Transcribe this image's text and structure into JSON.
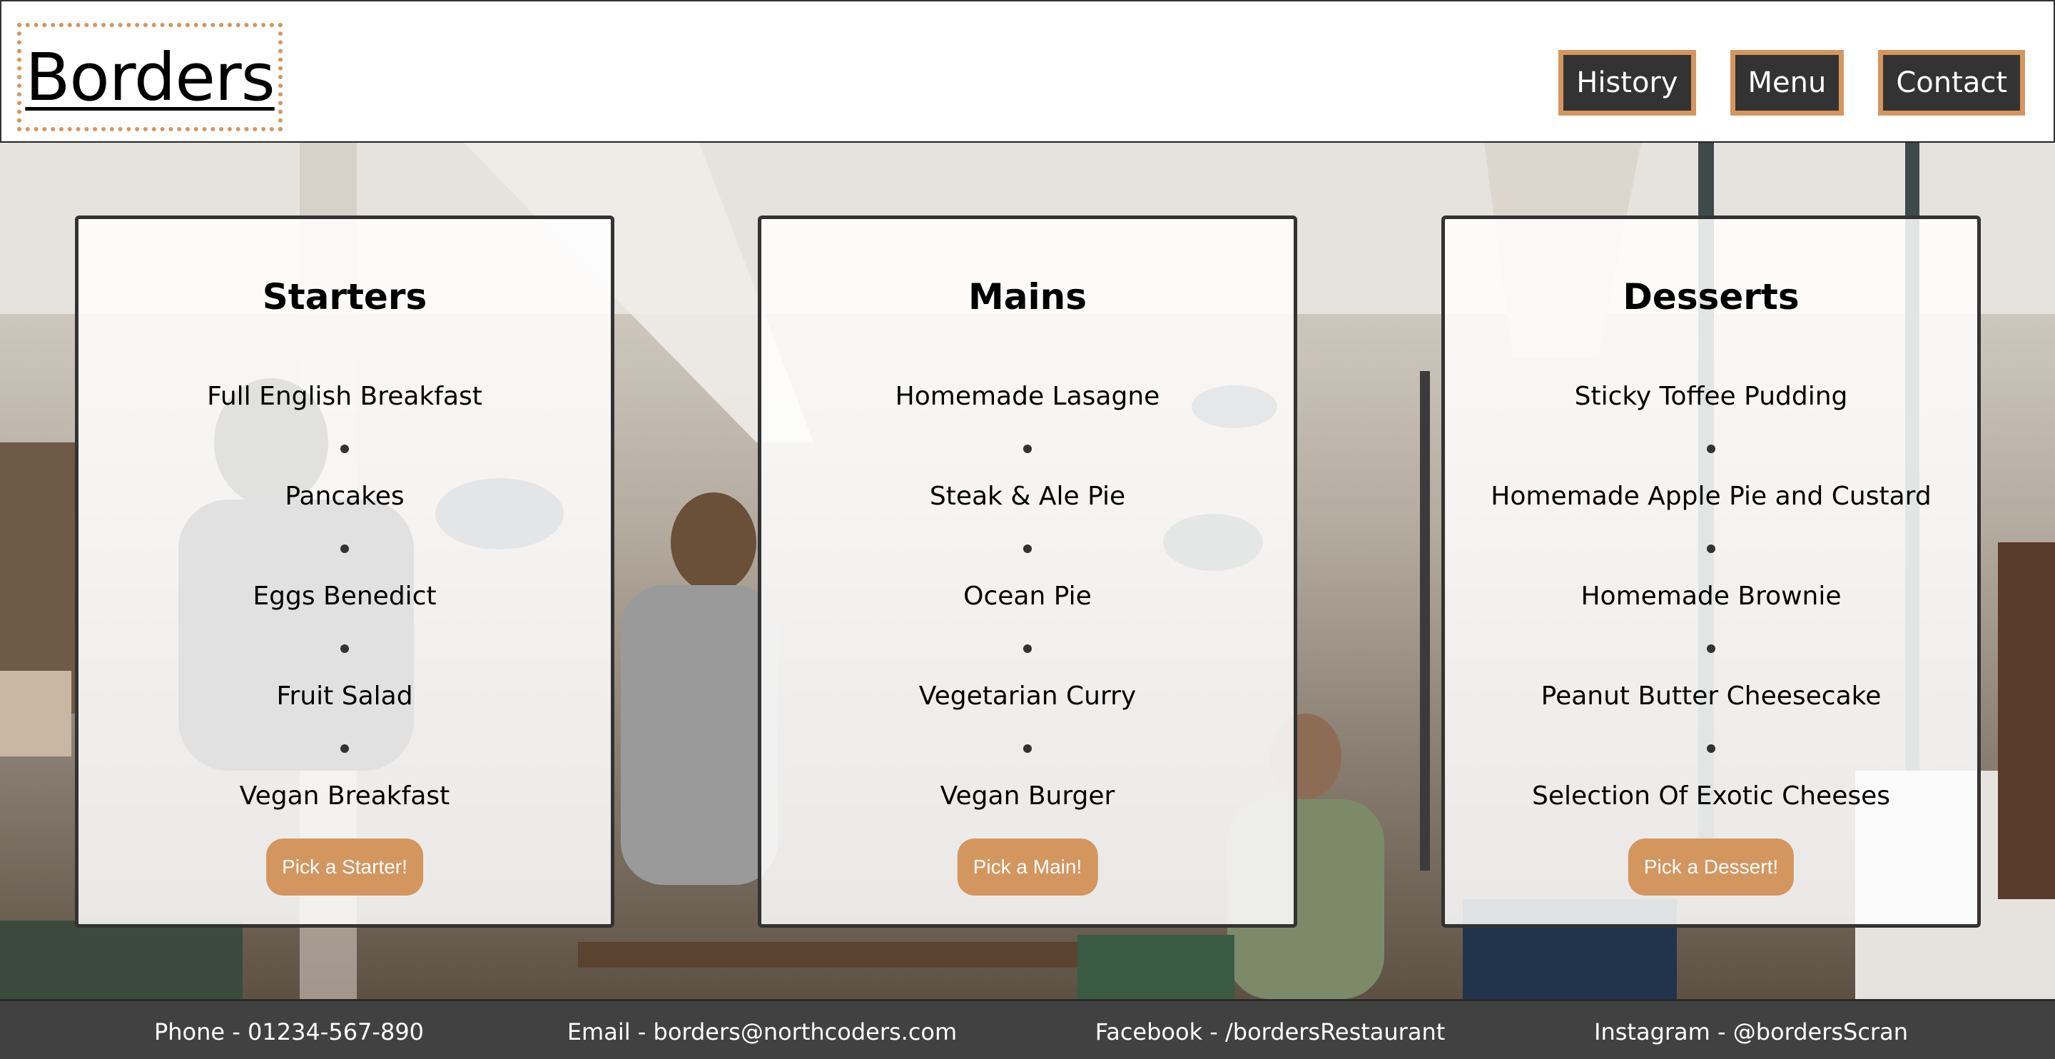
{
  "header": {
    "logo": "Borders",
    "nav": [
      "History",
      "Menu",
      "Contact"
    ]
  },
  "menu": [
    {
      "title": "Starters",
      "dishes": [
        "Full English Breakfast",
        "Pancakes",
        "Eggs Benedict",
        "Fruit Salad",
        "Vegan Breakfast"
      ],
      "button": "Pick a Starter!"
    },
    {
      "title": "Mains",
      "dishes": [
        "Homemade Lasagne",
        "Steak & Ale Pie",
        "Ocean Pie",
        "Vegetarian Curry",
        "Vegan Burger"
      ],
      "button": "Pick a Main!"
    },
    {
      "title": "Desserts",
      "dishes": [
        "Sticky Toffee Pudding",
        "Homemade Apple Pie and Custard",
        "Homemade Brownie",
        "Peanut Butter Cheesecake",
        "Selection Of Exotic Cheeses"
      ],
      "button": "Pick a Dessert!"
    }
  ],
  "footer": {
    "phone": "Phone - 01234-567-890",
    "email": "Email - borders@northcoders.com",
    "facebook": "Facebook - /bordersRestaurant",
    "instagram": "Instagram - @bordersScran"
  },
  "colors": {
    "accent": "#d4965f",
    "dark": "#333333",
    "footer": "#414141"
  }
}
